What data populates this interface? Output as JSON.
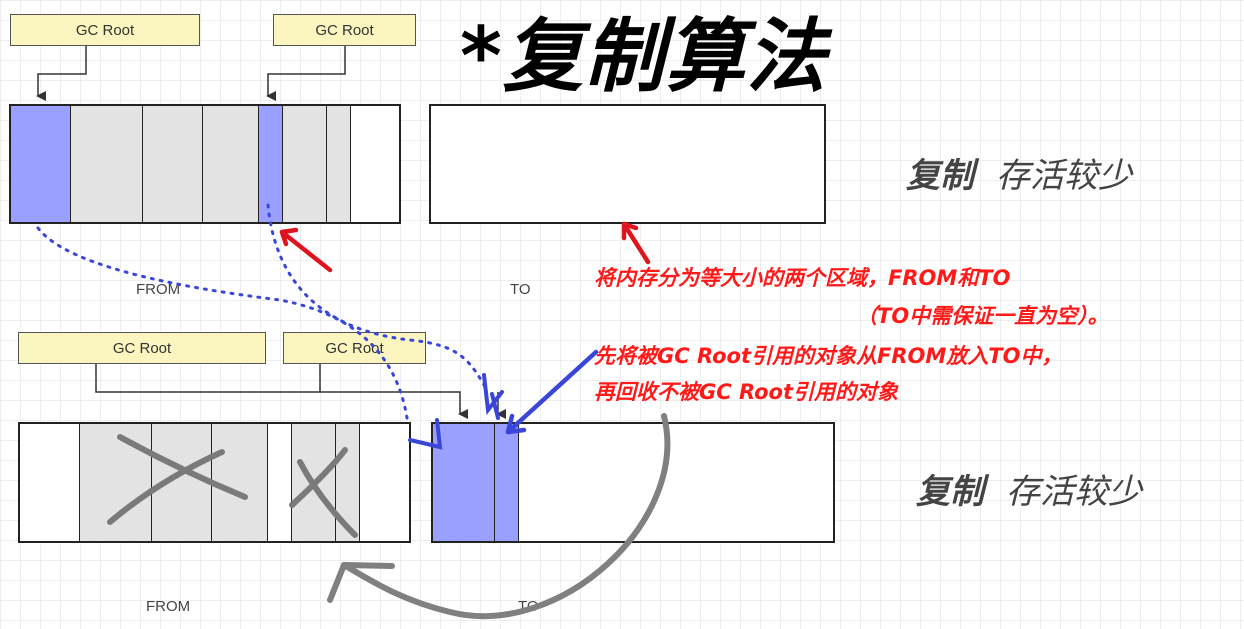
{
  "title": "*复制算法",
  "top_diagram": {
    "gc_root_left": "GC Root",
    "gc_root_right": "GC Root",
    "from_label": "FROM",
    "to_label": "TO"
  },
  "bottom_diagram": {
    "gc_root_left": "GC Root",
    "gc_root_right": "GC Root",
    "from_label": "FROM",
    "to_label": "TO"
  },
  "side_top": {
    "bold": "复制",
    "italic": "存活较少"
  },
  "side_bottom": {
    "bold": "复制",
    "italic": "存活较少"
  },
  "notes": {
    "line1": "将内存分为等大小的两个区域，FROM和TO",
    "line2": "（TO中需保证一直为空）。",
    "line3": "先将被GC Root引用的对象从FROM放入TO中，",
    "line4": "再回收不被GC Root引用的对象"
  },
  "colors": {
    "live_object": "#9aa0ff",
    "dead_object": "#e3e3e3",
    "annotation_red": "#ff1a1a",
    "annotation_blue": "#3a46d8",
    "annotation_gray": "#808080"
  }
}
